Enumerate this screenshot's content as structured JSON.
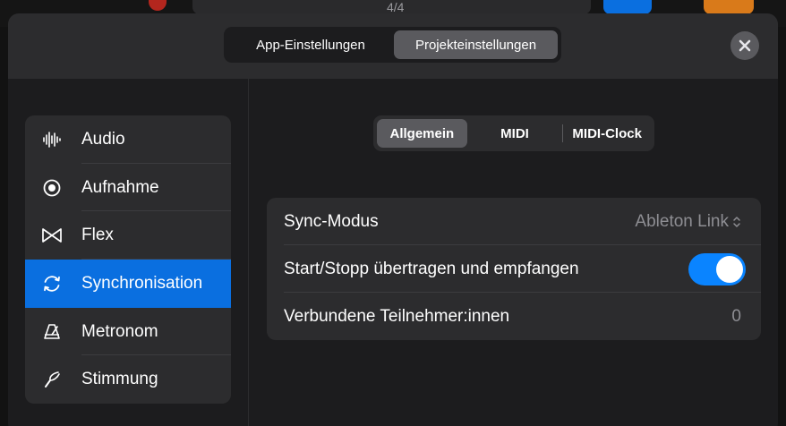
{
  "background": {
    "time_signature": "4/4"
  },
  "header": {
    "tabs": [
      {
        "label": "App-Einstellungen",
        "selected": false
      },
      {
        "label": "Projekteinstellungen",
        "selected": true
      }
    ],
    "close_icon": "close-icon"
  },
  "sidebar": {
    "items": [
      {
        "label": "Audio",
        "icon": "waveform-icon",
        "selected": false
      },
      {
        "label": "Aufnahme",
        "icon": "record-icon",
        "selected": false
      },
      {
        "label": "Flex",
        "icon": "flex-icon",
        "selected": false
      },
      {
        "label": "Synchronisation",
        "icon": "sync-icon",
        "selected": true
      },
      {
        "label": "Metronom",
        "icon": "metronome-icon",
        "selected": false
      },
      {
        "label": "Stimmung",
        "icon": "tuning-icon",
        "selected": false
      }
    ]
  },
  "subtabs": [
    {
      "label": "Allgemein",
      "selected": true
    },
    {
      "label": "MIDI",
      "selected": false
    },
    {
      "label": "MIDI-Clock",
      "selected": false
    }
  ],
  "settings": {
    "sync_mode": {
      "label": "Sync-Modus",
      "value": "Ableton Link"
    },
    "start_stop": {
      "label": "Start/Stopp übertragen und empfangen",
      "enabled": true
    },
    "participants": {
      "label": "Verbundene Teilnehmer:innen",
      "value": "0"
    }
  },
  "colors": {
    "accent": "#0a6fe0",
    "toggle_on": "#0a84ff",
    "sheet_bg": "#1c1c1e",
    "panel_bg": "#2c2c2e",
    "secondary_text": "#8e8e93"
  }
}
